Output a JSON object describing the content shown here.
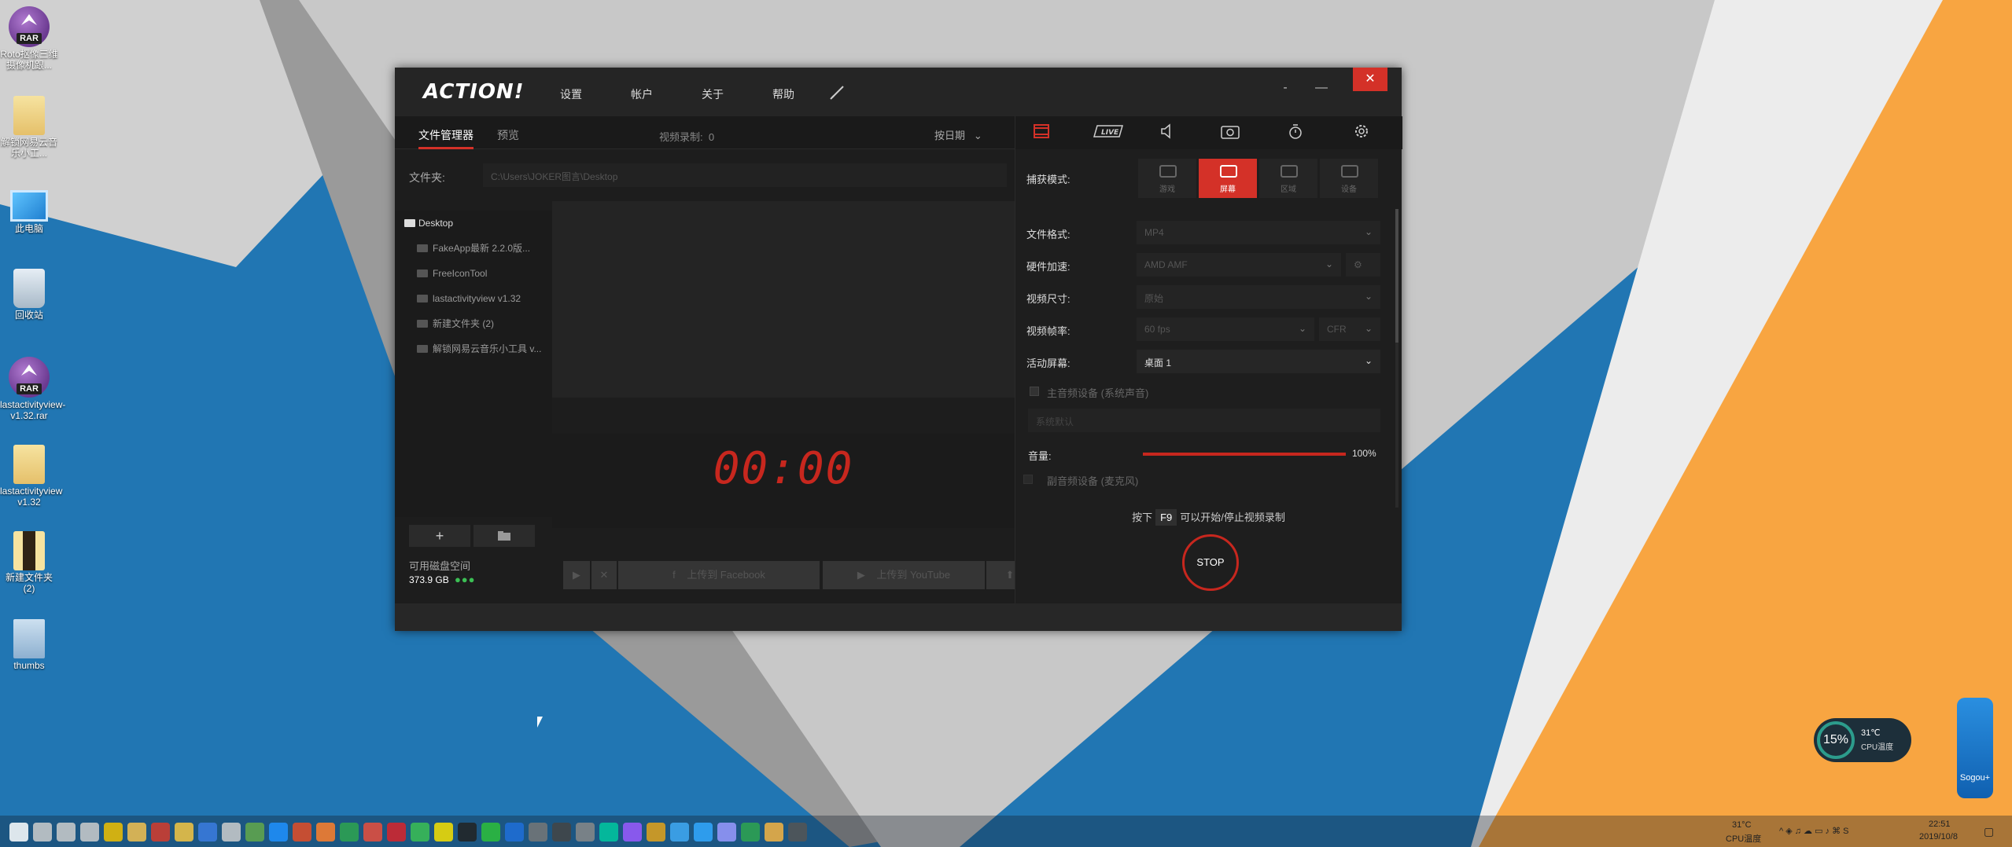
{
  "desktop": {
    "icons": [
      {
        "label": "Roto抠像三维摄像机跟...",
        "type": "rar",
        "badge": "RAR"
      },
      {
        "label": "解锁网易云音乐小工...",
        "type": "folder"
      },
      {
        "label": "此电脑",
        "type": "pc"
      },
      {
        "label": "回收站",
        "type": "bin"
      },
      {
        "label": "lastactivityview-v1.32.rar",
        "type": "rar",
        "badge": "RAR"
      },
      {
        "label": "lastactivityview v1.32",
        "type": "folder"
      },
      {
        "label": "新建文件夹 (2)",
        "type": "folder-dark"
      },
      {
        "label": "thumbs",
        "type": "thumb"
      }
    ]
  },
  "app": {
    "logo": "ACTION!",
    "menu": [
      "设置",
      "帐户",
      "关于",
      "帮助"
    ],
    "window_controls": {
      "more": "-",
      "minimize": "—",
      "close": "✕"
    },
    "tabs": {
      "file_manager": "文件管理器",
      "preview": "预览"
    },
    "recordings_count_label": "视频录制:",
    "recordings_count": "0",
    "sort": "按日期",
    "folder_label": "文件夹:",
    "folder_path": "C:\\Users\\JOKER图言\\Desktop",
    "tree": [
      {
        "label": "Desktop",
        "root": true
      },
      {
        "label": "FakeApp最新 2.2.0版...",
        "root": false
      },
      {
        "label": "FreeIconTool",
        "root": false
      },
      {
        "label": "lastactivityview v1.32",
        "root": false
      },
      {
        "label": "新建文件夹 (2)",
        "root": false
      },
      {
        "label": "解锁网易云音乐小工具 v...",
        "root": false
      }
    ],
    "timer": "00:00",
    "add_button": "+",
    "disk": {
      "label": "可用磁盘空间",
      "value": "373.9 GB",
      "dots": "●●●"
    },
    "upload_facebook": "上传到 Facebook",
    "upload_youtube": "上传到 YouTube",
    "right_tabs": [
      "video",
      "LIVE",
      "audio",
      "screenshot",
      "timer",
      "settings"
    ],
    "capture": {
      "label": "捕获模式:",
      "modes": [
        {
          "label": "游戏",
          "active": false
        },
        {
          "label": "屏幕",
          "active": true
        },
        {
          "label": "区域",
          "active": false
        },
        {
          "label": "设备",
          "active": false
        }
      ]
    },
    "settings": [
      {
        "label": "文件格式:",
        "value": "MP4",
        "enabled": false
      },
      {
        "label": "硬件加速:",
        "value": "AMD AMF",
        "enabled": false
      },
      {
        "label": "视频尺寸:",
        "value": "原始",
        "enabled": false
      },
      {
        "label": "视频帧率:",
        "value": "60 fps",
        "enabled": false,
        "extra": "CFR"
      },
      {
        "label": "活动屏幕:",
        "value": "桌面 1",
        "enabled": true
      }
    ],
    "audio": {
      "main_device": "主音频设备 (系统声音)",
      "main_default": "系统默认",
      "volume_label": "音量:",
      "volume": 100,
      "volume_text": "100%",
      "secondary_device": "副音频设备 (麦克风)"
    },
    "hint_pre": "按下",
    "hint_key": "F9",
    "hint_post": "可以开始/停止视频录制",
    "stop_label": "STOP"
  },
  "widget": {
    "cpu_percent": "15%",
    "temp": "31℃",
    "temp_label": "CPU温度"
  },
  "sogou_label": "Sogou+",
  "taskbar": {
    "icons": [
      "windows-start-icon",
      "search-icon",
      "cortana-icon",
      "task-view-icon",
      "magnifier-icon",
      "file-explorer-icon",
      "app-icon",
      "shield-icon",
      "word-icon",
      "app-icon",
      "app-icon",
      "edge-icon",
      "chrome-icon",
      "firefox-icon",
      "app-icon",
      "app-icon",
      "netease-music-icon",
      "app-icon",
      "app-icon",
      "qq-icon",
      "wechat-icon",
      "app-icon",
      "app-icon",
      "action-icon",
      "app-icon",
      "audition-icon",
      "after-effects-icon",
      "bridge-icon",
      "lightroom-icon",
      "photoshop-icon",
      "premiere-icon",
      "app-icon",
      "app-icon",
      "action-active-icon"
    ],
    "tray_temp": "31°C",
    "tray_temp_label": "CPU温度",
    "time": "22:51",
    "date": "2019/10/8"
  },
  "colors": {
    "accent": "#d43128",
    "timer": "#c7271e",
    "desktop_blue": "#2176b3",
    "desktop_orange": "#f8a541",
    "desktop_grey": "#c8c8c8"
  }
}
